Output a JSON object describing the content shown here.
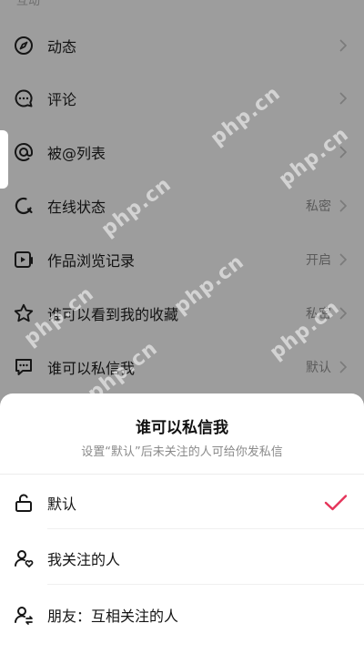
{
  "section_header": "互动",
  "settings": [
    {
      "id": "dynamic",
      "label": "动态",
      "value": "",
      "icon": "compass-icon"
    },
    {
      "id": "comments",
      "label": "评论",
      "value": "",
      "icon": "chat-bubble-icon"
    },
    {
      "id": "mentions",
      "label": "被@列表",
      "value": "",
      "icon": "at-sign-icon"
    },
    {
      "id": "online-status",
      "label": "在线状态",
      "value": "私密",
      "icon": "status-circle-icon"
    },
    {
      "id": "watch-history",
      "label": "作品浏览记录",
      "value": "开启",
      "icon": "video-play-icon"
    },
    {
      "id": "favorites-visibility",
      "label": "谁可以看到我的收藏",
      "value": "私密",
      "icon": "star-icon"
    },
    {
      "id": "direct-message",
      "label": "谁可以私信我",
      "value": "默认",
      "icon": "message-dots-icon"
    }
  ],
  "sheet": {
    "title": "谁可以私信我",
    "subtitle": "设置“默认”后未关注的人可给你发私信",
    "options": [
      {
        "id": "default",
        "label": "默认",
        "icon": "unlock-icon",
        "selected": true
      },
      {
        "id": "following",
        "label": "我关注的人",
        "icon": "user-heart-icon",
        "selected": false
      },
      {
        "id": "friends",
        "label": "朋友：互相关注的人",
        "icon": "user-mutual-icon",
        "selected": false
      }
    ]
  },
  "watermark": "php.cn",
  "colors": {
    "accent_check": "#e5345a",
    "overlay": "#9d9d9d",
    "sheet": "#ffffff"
  }
}
